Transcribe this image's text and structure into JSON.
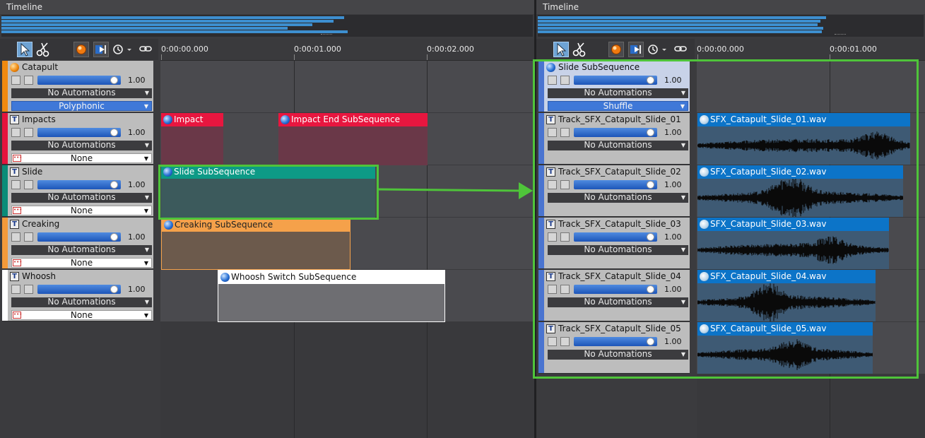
{
  "left": {
    "title": "Timeline",
    "ruler": [
      "0:00:00.000",
      "0:00:01.000",
      "0:00:02.000"
    ],
    "tracks": [
      {
        "name": "Catapult",
        "volume": "1.00",
        "volume_level": 0.92,
        "automations": "No Automations",
        "mode": "Polyphonic",
        "color": "#f08a10",
        "icon": "orb"
      },
      {
        "name": "Impacts",
        "volume": "1.00",
        "volume_level": 0.92,
        "automations": "No Automations",
        "mode": "None",
        "color": "#e5133c",
        "icon": "T"
      },
      {
        "name": "Slide",
        "volume": "1.00",
        "volume_level": 0.92,
        "automations": "No Automations",
        "mode": "None",
        "color": "#0a8c78",
        "icon": "T"
      },
      {
        "name": "Creaking",
        "volume": "1.00",
        "volume_level": 0.92,
        "automations": "No Automations",
        "mode": "None",
        "color": "#f39a3a",
        "icon": "T"
      },
      {
        "name": "Whoosh",
        "volume": "1.00",
        "volume_level": 0.92,
        "automations": "No Automations",
        "mode": "None",
        "color": "#ffffff",
        "icon": "T"
      }
    ],
    "clips": [
      {
        "label": "Impact",
        "header_color": "#e8163f",
        "body_color": "#6a3848"
      },
      {
        "label": "Impact End SubSequence",
        "header_color": "#e8163f",
        "body_color": "#6a3848"
      },
      {
        "label": "Slide SubSequence",
        "header_color": "#0d9a86",
        "body_color": "#3c5a5c"
      },
      {
        "label": "Creaking SubSequence",
        "header_color": "#f5a14a",
        "body_color": "#6c5a4c"
      },
      {
        "label": "Whoosh Switch SubSequence",
        "header_color": "#ffffff",
        "body_color": "#6e6e72"
      }
    ]
  },
  "right": {
    "title": "Timeline",
    "ruler": [
      "0:00:00.000",
      "0:00:01.000"
    ],
    "parent": {
      "name": "Slide SubSequence",
      "volume": "1.00",
      "volume_level": 0.92,
      "automations": "No Automations",
      "mode": "Shuffle",
      "color": "#4a74d0"
    },
    "tracks": [
      {
        "name": "Track_SFX_Catapult_Slide_01",
        "volume": "1.00",
        "volume_level": 0.92,
        "automations": "No Automations",
        "clip": "SFX_Catapult_Slide_01.wav",
        "length": 1.6
      },
      {
        "name": "Track_SFX_Catapult_Slide_02",
        "volume": "1.00",
        "volume_level": 0.92,
        "automations": "No Automations",
        "clip": "SFX_Catapult_Slide_02.wav",
        "length": 1.55
      },
      {
        "name": "Track_SFX_Catapult_Slide_03",
        "volume": "1.00",
        "volume_level": 0.92,
        "automations": "No Automations",
        "clip": "SFX_Catapult_Slide_03.wav",
        "length": 1.44
      },
      {
        "name": "Track_SFX_Catapult_Slide_04",
        "volume": "1.00",
        "volume_level": 0.92,
        "automations": "No Automations",
        "clip": "SFX_Catapult_Slide_04.wav",
        "length": 1.34
      },
      {
        "name": "Track_SFX_Catapult_Slide_05",
        "volume": "1.00",
        "volume_level": 0.92,
        "automations": "No Automations",
        "clip": "SFX_Catapult_Slide_05.wav",
        "length": 1.32
      }
    ]
  },
  "icons": [
    "pointer-tool-icon",
    "scissors-tool-icon",
    "record-orb-icon",
    "snap-arrow-icon",
    "clock-icon",
    "link-icon",
    "text-track-icon",
    "blend-orb-icon",
    "random-icon",
    "wav-file-icon"
  ],
  "colors": {
    "highlight": "#4fc43a",
    "accent_blue": "#3d8fd0"
  }
}
